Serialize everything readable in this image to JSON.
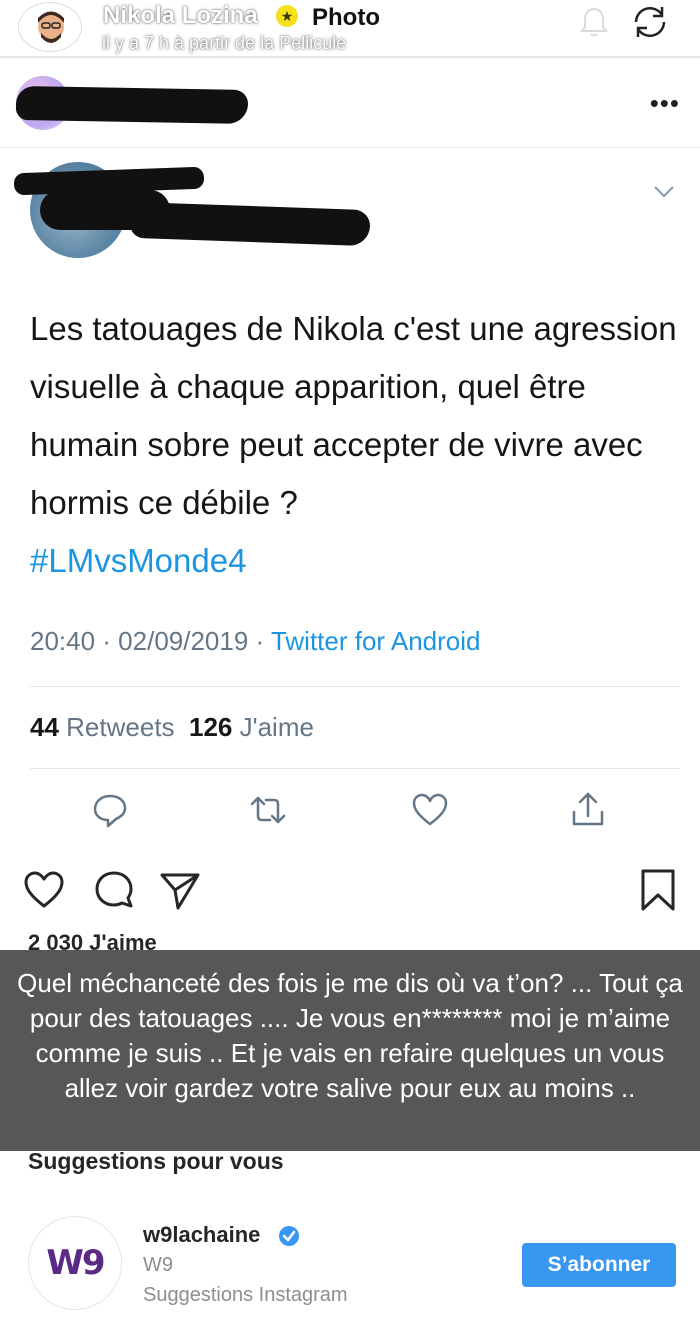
{
  "snap": {
    "user": "Nikola Lozina",
    "kind": "Photo",
    "subtitle": "il y a 7 h à partir de la Pellicule",
    "caption": "Quel méchanceté des fois je me dis où va t’on? ... Tout ça pour des tatouages .... Je vous en******** moi je m’aime comme je suis .. Et je vais en refaire quelques un vous allez voir gardez votre salive pour eux au moins .."
  },
  "tweet": {
    "text": "Les tatouages de Nikola c'est une agression visuelle à chaque apparition, quel être humain sobre peut accepter de vivre avec hormis ce débile ?",
    "hashtag": "#LMvsMonde4",
    "time": "20:40 · 02/09/2019 · ",
    "source": "Twitter for Android",
    "retweets": "44",
    "retweets_label": "Retweets",
    "likes": "126",
    "likes_label": "J'aime"
  },
  "instagram": {
    "likes": "2 030 J'aime",
    "suggestions_title": "Suggestions pour vous",
    "suggestion": {
      "username": "w9lachaine",
      "name": "W9",
      "context": "Suggestions Instagram",
      "logo_text": "W9",
      "follow_label": "S’abonner"
    }
  },
  "icons": [
    "bitmoji-avatar",
    "star-icon",
    "bell-icon",
    "rotate-icon",
    "more-icon",
    "chevron-down-icon",
    "reply-icon",
    "retweet-icon",
    "heart-icon",
    "share-icon",
    "like-icon",
    "comment-icon",
    "send-icon",
    "bookmark-icon",
    "verified-icon"
  ],
  "colors": {
    "twitter_blue": "#1b95e0",
    "instagram_blue": "#3897f0",
    "snap_yellow": "#f7e01c"
  }
}
